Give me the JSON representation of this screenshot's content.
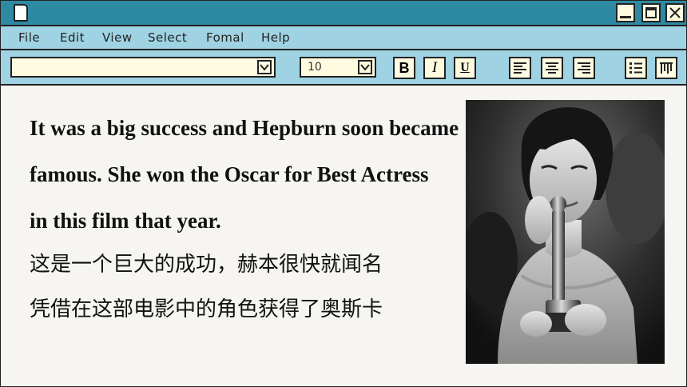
{
  "window": {
    "title_icon": "document-icon"
  },
  "menu": {
    "items": [
      "File",
      "Edit",
      "View",
      "Select",
      "Fomal",
      "Help"
    ]
  },
  "toolbar": {
    "style_value": "",
    "font_size": "10",
    "bold_label": "B",
    "italic_label": "I",
    "underline_label": "U"
  },
  "content": {
    "english_lines": [
      "It was a big success and Hepburn soon became",
      "famous. She won the Oscar for Best Actress",
      "in this film that year."
    ],
    "chinese_lines": [
      "这是一个巨大的成功，赫本很快就闻名",
      "凭借在这部电影中的角色获得了奥斯卡"
    ]
  },
  "colors": {
    "titlebar": "#2e8aa3",
    "menubar": "#9fd3e3",
    "input_bg": "#fffbe0",
    "page_bg": "#f6f5f1"
  }
}
